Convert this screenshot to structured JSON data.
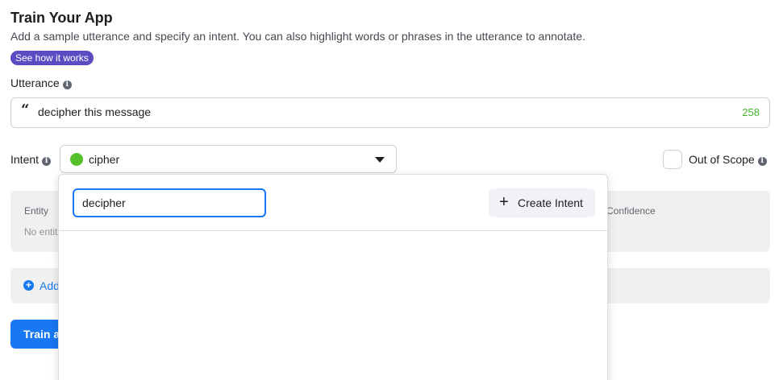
{
  "header": {
    "title": "Train Your App",
    "subtitle": "Add a sample utterance and specify an intent. You can also highlight words or phrases in the utterance to annotate.",
    "how_badge": "See how it works"
  },
  "utterance": {
    "label": "Utterance",
    "value": "decipher this message",
    "char_count": "258"
  },
  "intent": {
    "label": "Intent",
    "selected": "cipher",
    "selected_color": "#56c02b"
  },
  "out_of_scope": {
    "label": "Out of Scope",
    "checked": false
  },
  "entities": {
    "column_entity": "Entity",
    "column_confidence": "Confidence",
    "empty_text": "No entit"
  },
  "add_row": {
    "label": "Add"
  },
  "train_button": {
    "label": "Train a"
  },
  "intent_dropdown": {
    "search_value": "decipher",
    "create_label": "Create Intent"
  },
  "colors": {
    "accent": "#1877f2",
    "badge": "#5b4cc4",
    "count": "#42b72a"
  }
}
